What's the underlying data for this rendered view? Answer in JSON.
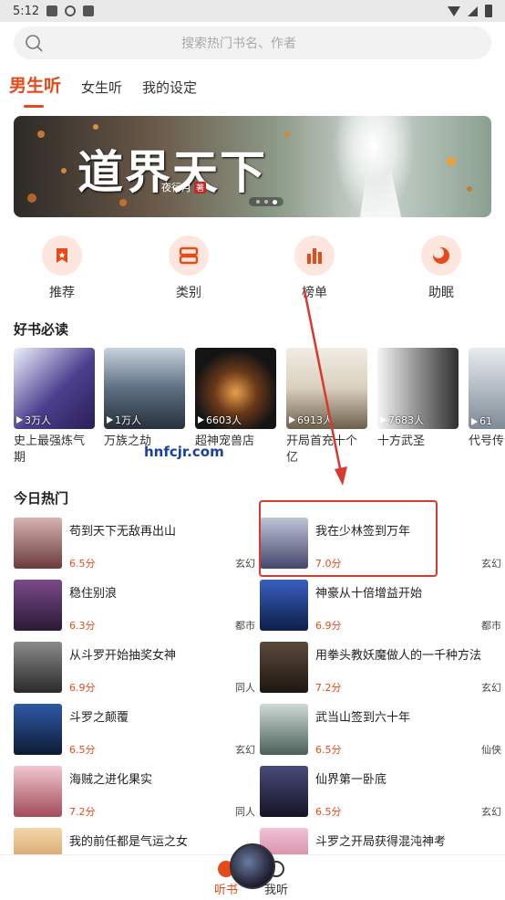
{
  "status_bar": {
    "time": "5:12"
  },
  "search": {
    "placeholder": "搜索热门书名、作者"
  },
  "tabs": [
    {
      "label": "男生听",
      "active": true
    },
    {
      "label": "女生听",
      "active": false
    },
    {
      "label": "我的设定",
      "active": false
    }
  ],
  "banner": {
    "title": "道界天下",
    "author": "夜行月",
    "author_tag": "著",
    "page_index": 3,
    "page_count": 3
  },
  "categories": [
    {
      "label": "推荐",
      "icon": "bookmark-icon"
    },
    {
      "label": "类别",
      "icon": "grid-icon"
    },
    {
      "label": "榜单",
      "icon": "bar-chart-icon"
    },
    {
      "label": "助眠",
      "icon": "moon-icon"
    }
  ],
  "must_read": {
    "title": "好书必读",
    "books": [
      {
        "name": "史上最强炼气期",
        "count": "3万人"
      },
      {
        "name": "万族之劫",
        "count": "1万人"
      },
      {
        "name": "超神宠兽店",
        "count": "6603人"
      },
      {
        "name": "开局首充十个亿",
        "count": "6913人"
      },
      {
        "name": "十方武圣",
        "count": "7683人"
      },
      {
        "name": "代号传",
        "count": "61"
      }
    ]
  },
  "watermark": "hnfcjr.com",
  "hot": {
    "title": "今日热门",
    "items": [
      {
        "title": "苟到天下无敌再出山",
        "score": "6.5分",
        "genre": "玄幻"
      },
      {
        "title": "我在少林签到万年",
        "score": "7.0分",
        "genre": "玄幻"
      },
      {
        "title": "稳住别浪",
        "score": "6.3分",
        "genre": "都市"
      },
      {
        "title": "神豪从十倍增益开始",
        "score": "6.9分",
        "genre": "都市"
      },
      {
        "title": "从斗罗开始抽奖女神",
        "score": "6.9分",
        "genre": "同人"
      },
      {
        "title": "用拳头教妖魔做人的一千种方法",
        "score": "7.2分",
        "genre": "玄幻"
      },
      {
        "title": "斗罗之颠覆",
        "score": "6.5分",
        "genre": "玄幻"
      },
      {
        "title": "武当山签到六十年",
        "score": "6.5分",
        "genre": "仙侠"
      },
      {
        "title": "海贼之进化果实",
        "score": "7.2分",
        "genre": "同人"
      },
      {
        "title": "仙界第一卧底",
        "score": "6.5分",
        "genre": "玄幻"
      },
      {
        "title": "我的前任都是气运之女",
        "score": "",
        "genre": ""
      },
      {
        "title": "斗罗之开局获得混沌神考",
        "score": "",
        "genre": ""
      }
    ]
  },
  "bottom_nav": [
    {
      "label": "听书",
      "active": true
    },
    {
      "label": "我听",
      "active": false
    }
  ],
  "colors": {
    "accent": "#e64a19",
    "annotation": "#d9382e"
  }
}
